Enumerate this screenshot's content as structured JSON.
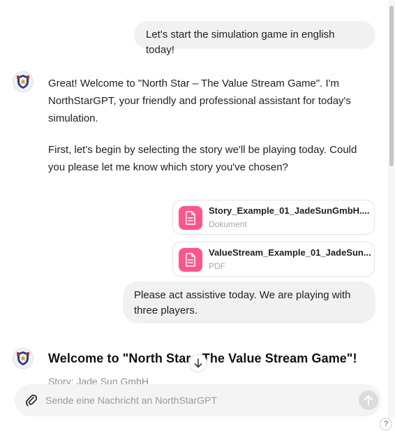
{
  "messages": {
    "user_1": "Let's start the simulation game in english today!",
    "assistant_1": {
      "paragraph_1": "Great! Welcome to \"North Star – The Value Stream Game\". I'm NorthStarGPT, your friendly and professional assistant for today's simulation.",
      "paragraph_2": "First, let's begin by selecting the story we'll be playing today. Could you please let me know which story you've chosen?"
    },
    "attachments": [
      {
        "name": "Story_Example_01_JadeSunGmbH....",
        "type": "Dokument"
      },
      {
        "name": "ValueStream_Example_01_JadeSun...",
        "type": "PDF"
      }
    ],
    "user_2": "Please act assistive today. We are playing with three players.",
    "assistant_2": {
      "heading": "Welcome to \"North Star - The Value Stream Game\"!",
      "faded_line": "Story: Jade Sun GmbH"
    }
  },
  "composer": {
    "placeholder": "Sende eine Nachricht an NorthStarGPT"
  },
  "help_label": "?",
  "colors": {
    "bubble": "#f1f1f1",
    "file_icon": "#ff5588",
    "send_disabled": "#dcdcdc"
  },
  "icons": {
    "avatar": "north-star-crest-icon",
    "file": "document-icon",
    "attach": "paperclip-icon",
    "send": "arrow-up-icon",
    "scroll": "arrow-down-icon"
  }
}
